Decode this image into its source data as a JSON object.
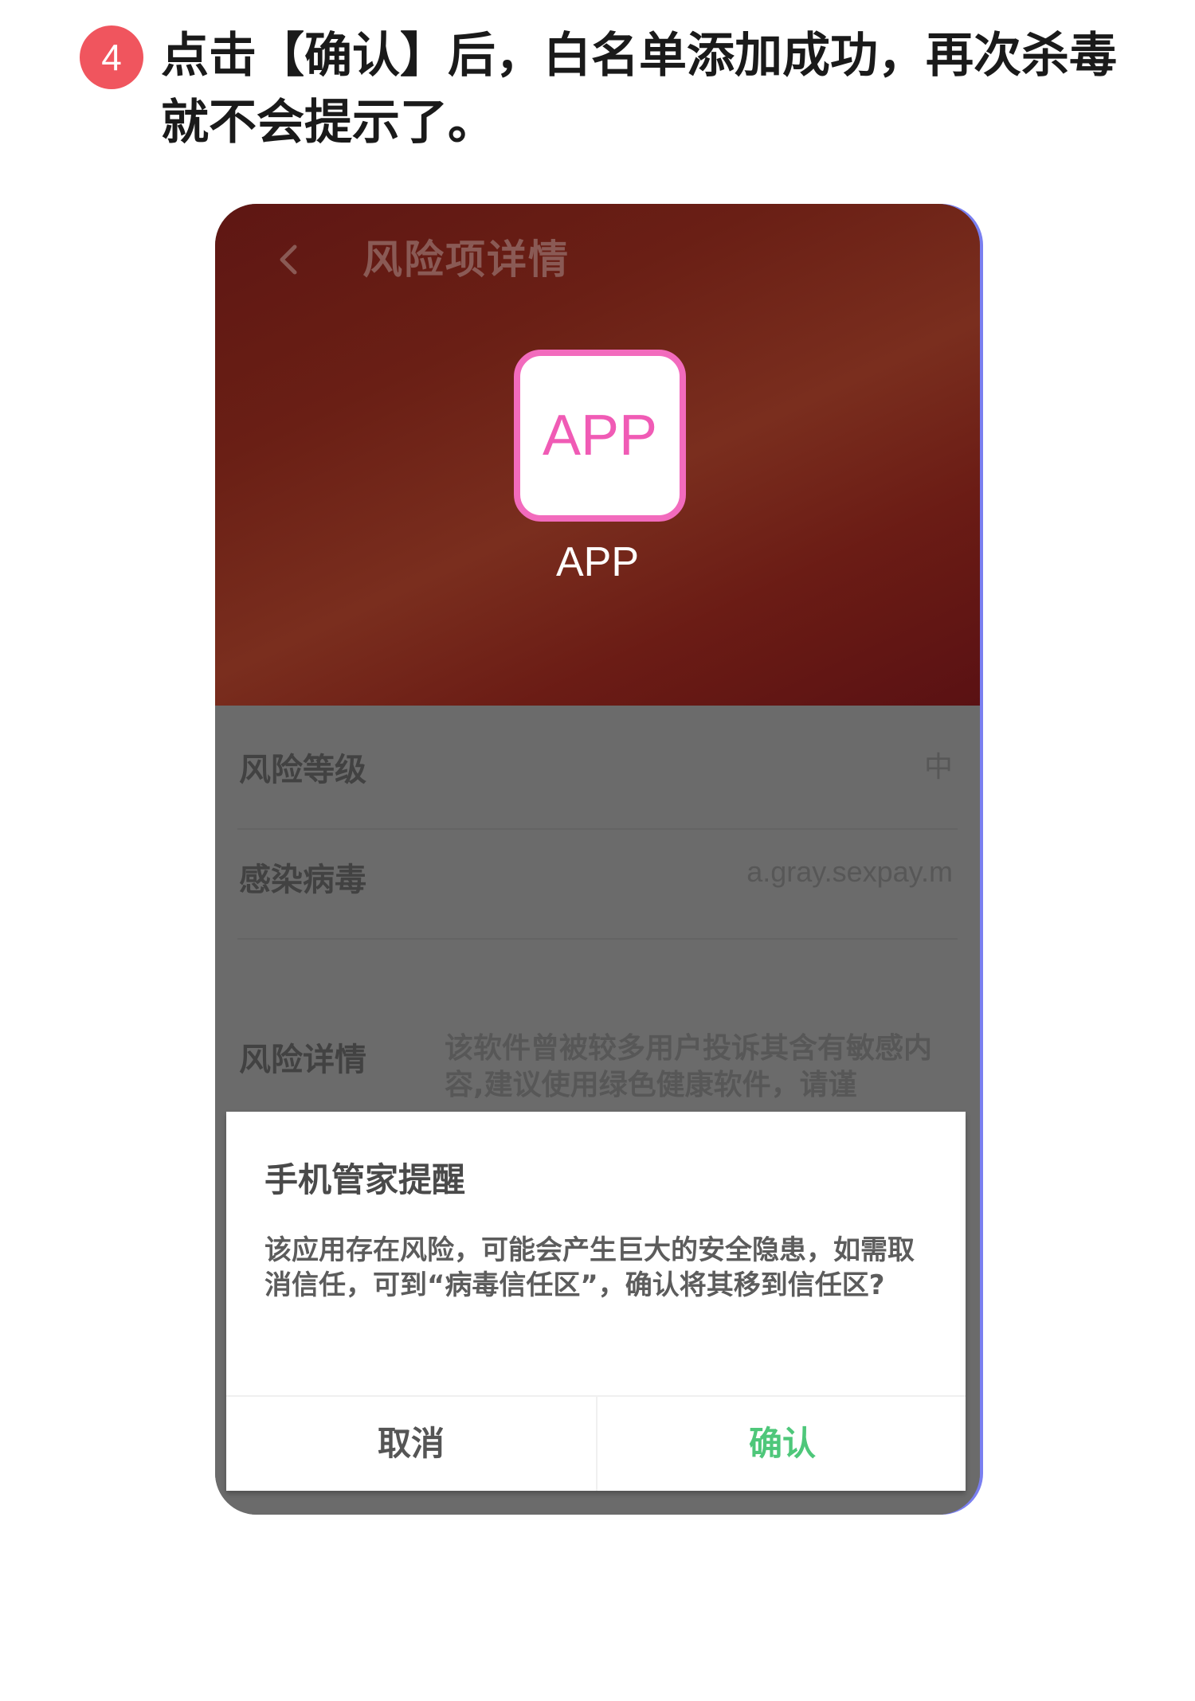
{
  "step": {
    "number": "4",
    "instruction": "点击【确认】后，白名单添加成功，再次杀毒就不会提示了。"
  },
  "screen": {
    "header": {
      "back_icon": "chevron-left-icon",
      "title": "风险项详情"
    },
    "app": {
      "icon_text": "APP",
      "name": "APP"
    },
    "details": [
      {
        "label": "风险等级",
        "value": "中"
      },
      {
        "label": "感染病毒",
        "value": "a.gray.sexpay.m"
      },
      {
        "label": "风险详情",
        "value": "该软件曾被较多用户投诉其含有敏感内容,建议使用绿色健康软件，请谨"
      }
    ],
    "dialog": {
      "title": "手机管家提醒",
      "message": "该应用存在风险，可能会产生巨大的安全隐患，如需取消信任，可到“病毒信任区”，确认将其移到信任区?",
      "cancel_label": "取消",
      "confirm_label": "确认"
    }
  },
  "colors": {
    "badge": "#f0555e",
    "app_icon_border": "#f26bbd",
    "confirm": "#4ec77a"
  }
}
